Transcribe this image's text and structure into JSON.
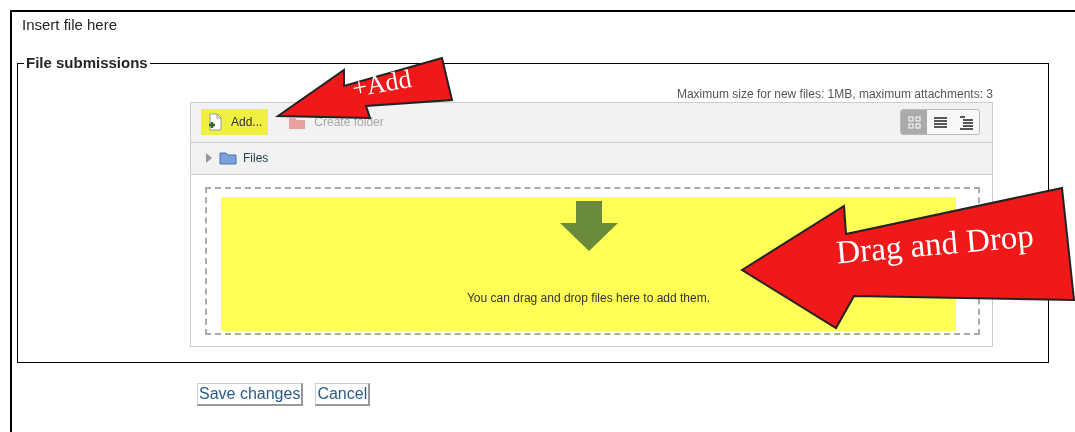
{
  "heading": "Insert file here",
  "fieldset": {
    "legend": "File submissions",
    "limits": "Maximum size for new files: 1MB, maximum attachments: 3",
    "toolbar": [
      {
        "kind": "add",
        "label": "Add...",
        "highlighted": true
      },
      {
        "kind": "folder",
        "label": "Create folder",
        "highlighted": false
      }
    ],
    "view_modes": [
      {
        "kind": "icons",
        "selected": true
      },
      {
        "kind": "list",
        "selected": false
      },
      {
        "kind": "tree",
        "selected": false
      }
    ],
    "path": {
      "label": "Files",
      "expanded": false
    },
    "dropzone": {
      "message": "You can drag and drop files here to add them.",
      "highlighted": true
    }
  },
  "callouts": [
    {
      "kind": "small",
      "text": "+Add"
    },
    {
      "kind": "large",
      "text": "Drag and Drop"
    }
  ],
  "buttons": [
    "Save changes",
    "Cancel"
  ]
}
